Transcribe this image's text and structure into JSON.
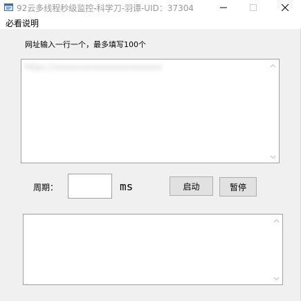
{
  "window": {
    "title": "92云多线程秒级监控-科学刀-羽谭-UID：37304",
    "icon": "app-icon"
  },
  "menu": {
    "items": [
      "必看说明"
    ]
  },
  "url_section": {
    "label": "网址输入一行一个，最多填写100个",
    "blurred_line": "https://xxxxxxxxxxxxxxxxxxxxxx"
  },
  "period": {
    "label": "周期：",
    "value": "",
    "unit": "ms"
  },
  "buttons": {
    "start": "启动",
    "pause": "暂停"
  },
  "log": {
    "content": ""
  }
}
